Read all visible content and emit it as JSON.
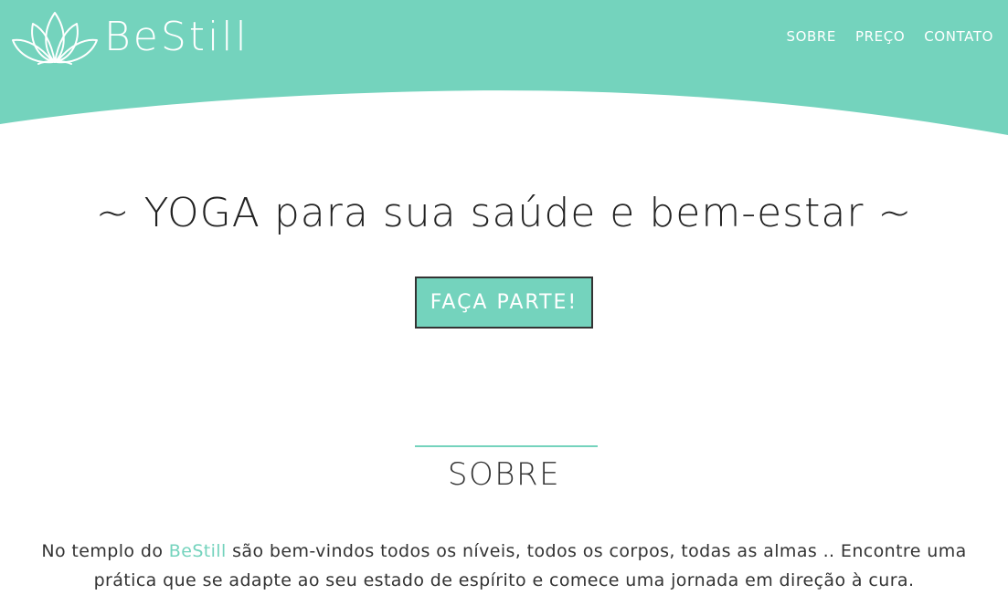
{
  "colors": {
    "accent": "#74d3bd",
    "text": "#333333",
    "white": "#ffffff"
  },
  "header": {
    "logo_icon": "lotus-icon",
    "logo_text": "BeStill",
    "nav": [
      {
        "label": "SOBRE"
      },
      {
        "label": "PREÇO"
      },
      {
        "label": "CONTATO"
      }
    ]
  },
  "hero": {
    "title": "~ YOGA para sua saúde e bem-estar ~",
    "cta_label": "FAÇA PARTE!"
  },
  "about": {
    "title": "SOBRE",
    "text_prefix": "No templo do ",
    "brand": "BeStill",
    "text_suffix": " são bem-vindos todos os níveis, todos os corpos, todas as almas .. Encontre uma prática que se adapte ao seu estado de espírito e comece uma jornada em direção à cura."
  }
}
